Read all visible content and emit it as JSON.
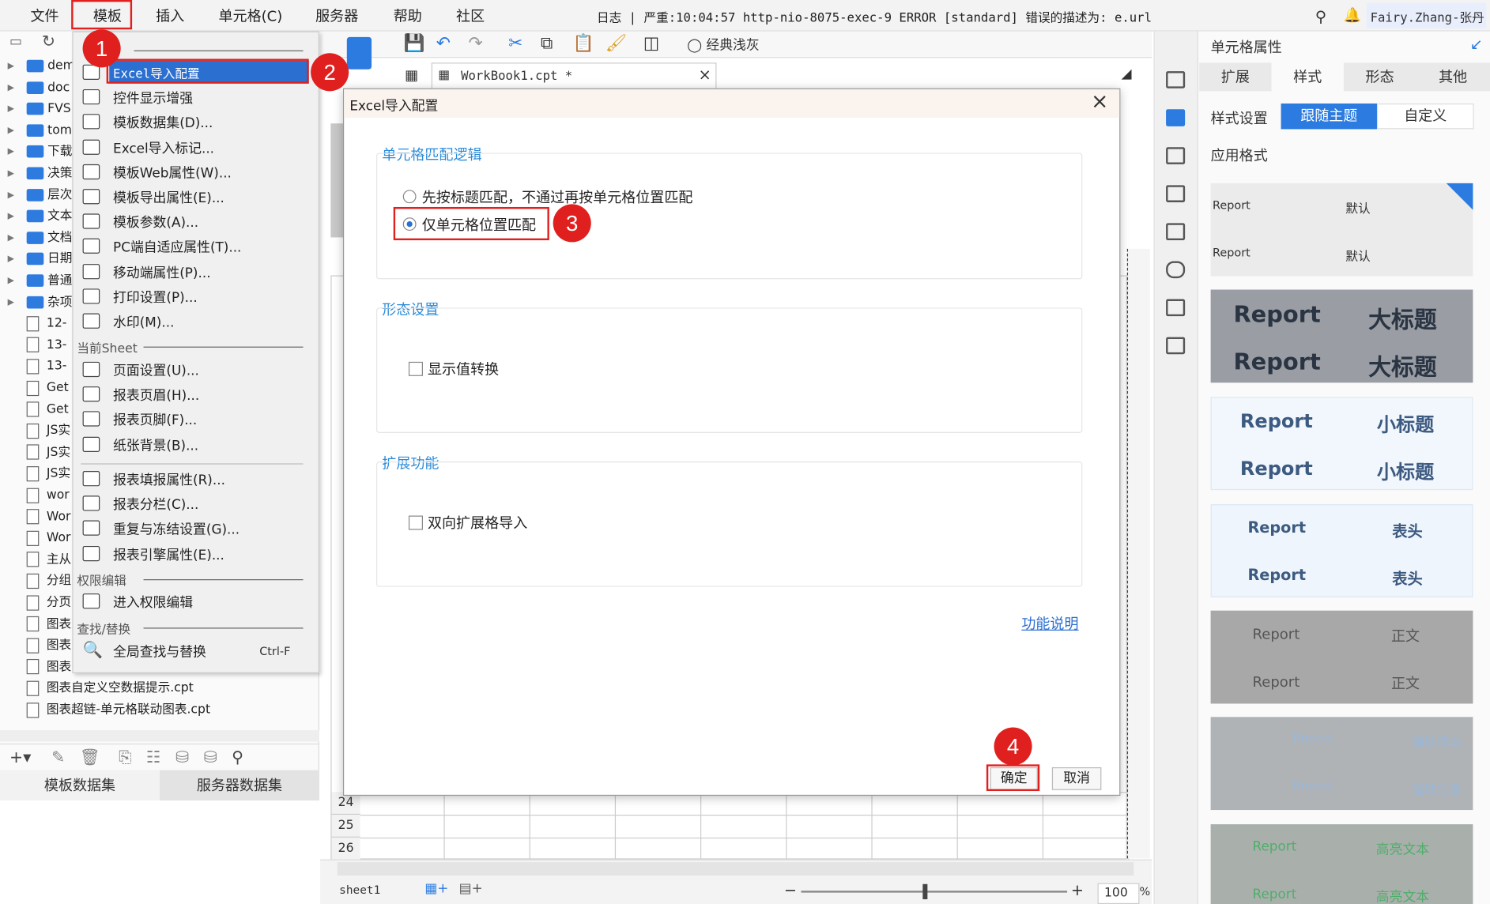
{
  "menubar": {
    "items": [
      "文件",
      "模板",
      "插入",
      "单元格(C)",
      "服务器",
      "帮助",
      "社区"
    ],
    "log_text": "日志 | 严重:10:04:57 http-nio-8075-exec-9 ERROR [standard] 错误的描述为: e.url",
    "user": "Fairy.Zhang-张丹"
  },
  "left_tree": {
    "folders": [
      "dem",
      "doc",
      "FVS",
      "tom",
      "下载",
      "决策",
      "层次",
      "文本",
      "文档",
      "日期",
      "普通",
      "杂项"
    ],
    "files": [
      "12-",
      "13-",
      "13-",
      "Get",
      "Get",
      "JS实",
      "JS实",
      "JS实",
      "wor",
      "Wor",
      "Wor",
      "主从",
      "分组",
      "分页",
      "图表",
      "图表",
      "图表",
      "图表自定义空数据提示.cpt",
      "图表超链-单元格联动图表.cpt"
    ],
    "tabs": [
      "模板数据集",
      "服务器数据集"
    ]
  },
  "template_menu": {
    "items": [
      {
        "label": "Excel导入配置",
        "icon": "excel-import-icon"
      },
      {
        "label": "控件显示增强",
        "icon": "widget-icon"
      },
      {
        "label": "模板数据集(D)...",
        "icon": "database-icon"
      },
      {
        "label": "Excel导入标记...",
        "icon": "excel-mark-icon"
      },
      {
        "label": "模板Web属性(W)...",
        "icon": "globe-icon"
      },
      {
        "label": "模板导出属性(E)...",
        "icon": "export-icon"
      },
      {
        "label": "模板参数(A)...",
        "icon": "param-icon"
      },
      {
        "label": "PC端自适应属性(T)...",
        "icon": "resize-icon"
      },
      {
        "label": "移动端属性(P)...",
        "icon": "mobile-icon"
      },
      {
        "label": "打印设置(P)...",
        "icon": "printer-icon"
      },
      {
        "label": "水印(M)...",
        "icon": "stamp-icon"
      }
    ],
    "section_sheet": "当前Sheet",
    "sheet_items": [
      {
        "label": "页面设置(U)...",
        "icon": "page-icon"
      },
      {
        "label": "报表页眉(H)...",
        "icon": "header-icon"
      },
      {
        "label": "报表页脚(F)...",
        "icon": "footer-icon"
      },
      {
        "label": "纸张背景(B)...",
        "icon": "image-icon"
      }
    ],
    "sheet_items2": [
      {
        "label": "报表填报属性(R)...",
        "icon": "fill-icon"
      },
      {
        "label": "报表分栏(C)...",
        "icon": "columns-icon"
      },
      {
        "label": "重复与冻结设置(G)...",
        "icon": "freeze-icon"
      },
      {
        "label": "报表引擎属性(E)...",
        "icon": "engine-icon"
      }
    ],
    "section_perm": "权限编辑",
    "perm_item": "进入权限编辑",
    "section_find": "查找/替换",
    "find_item": "全局查找与替换",
    "find_shortcut": "Ctrl-F"
  },
  "toolbar": {
    "classic_label": "经典浅灰"
  },
  "tab": {
    "title": "WorkBook1.cpt *"
  },
  "grid": {
    "rows": [
      "24",
      "25",
      "26"
    ]
  },
  "dialog": {
    "title": "Excel导入配置",
    "group1": "单元格匹配逻辑",
    "radio1": "先按标题匹配，不通过再按单元格位置匹配",
    "radio2": "仅单元格位置匹配",
    "group2": "形态设置",
    "check1": "显示值转换",
    "group3": "扩展功能",
    "check2": "双向扩展格导入",
    "help_link": "功能说明",
    "ok": "确定",
    "cancel": "取消"
  },
  "badges": [
    "1",
    "2",
    "3",
    "4"
  ],
  "right_panel": {
    "title": "单元格属性",
    "tabs": [
      "扩展",
      "样式",
      "形态",
      "其他"
    ],
    "style_setting_label": "样式设置",
    "follow_theme": "跟随主题",
    "custom": "自定义",
    "apply_format": "应用格式",
    "cards": [
      {
        "a": "Report",
        "b": "默认"
      },
      {
        "a": "Report",
        "b": "大标题"
      },
      {
        "a": "Report",
        "b": "小标题"
      },
      {
        "a": "Report",
        "b": "表头"
      },
      {
        "a": "Report",
        "b": "正文"
      },
      {
        "a": "Report",
        "b": "辅助信息"
      },
      {
        "a": "Report",
        "b": "高亮文本"
      }
    ]
  },
  "status": {
    "sheet": "sheet1",
    "zoom": "100",
    "percent": "%"
  }
}
